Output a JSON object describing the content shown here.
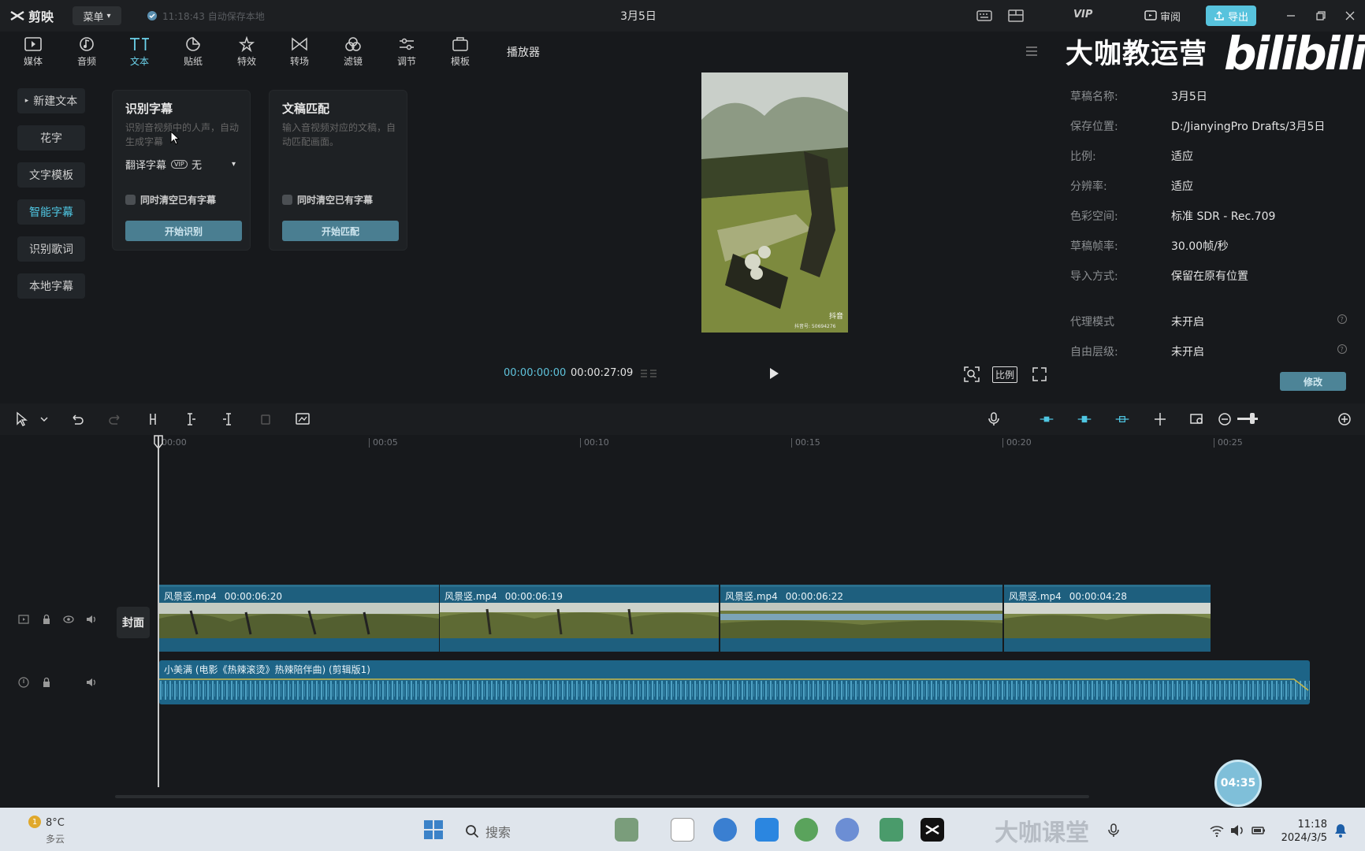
{
  "app": {
    "name": "剪映",
    "menu_label": "菜单",
    "save_status": "11:18:43 自动保存本地",
    "project_title": "3月5日",
    "vip_label": "VIP",
    "review_label": "审阅",
    "export_label": "导出"
  },
  "toolbar": {
    "items": [
      {
        "label": "媒体",
        "icon": "media-icon"
      },
      {
        "label": "音频",
        "icon": "audio-icon"
      },
      {
        "label": "文本",
        "icon": "text-icon"
      },
      {
        "label": "贴纸",
        "icon": "sticker-icon"
      },
      {
        "label": "特效",
        "icon": "effects-icon"
      },
      {
        "label": "转场",
        "icon": "transition-icon"
      },
      {
        "label": "滤镜",
        "icon": "filter-icon"
      },
      {
        "label": "调节",
        "icon": "adjust-icon"
      },
      {
        "label": "模板",
        "icon": "template-icon"
      }
    ],
    "active": "文本"
  },
  "text_panel": {
    "nav": [
      "新建文本",
      "花字",
      "文字模板",
      "智能字幕",
      "识别歌词",
      "本地字幕"
    ],
    "active_nav": "智能字幕",
    "cards": [
      {
        "title": "识别字幕",
        "desc": "识别音视频中的人声，自动生成字幕",
        "translate_label": "翻译字幕",
        "translate_badge": "VIP",
        "translate_value": "无",
        "checkbox": "同时清空已有字幕",
        "button": "开始识别"
      },
      {
        "title": "文稿匹配",
        "desc": "输入音视频对应的文稿，自动匹配画面。",
        "checkbox": "同时清空已有字幕",
        "button": "开始匹配"
      }
    ]
  },
  "player": {
    "title": "播放器",
    "current_time": "00:00:00:00",
    "total_time": "00:00:27:09",
    "ratio_label": "比例",
    "preview_watermark": "抖音",
    "preview_id": "抖音号: 50694276"
  },
  "watermark": {
    "text": "大咖教运营",
    "brand": "bilibili"
  },
  "draft": {
    "rows": [
      {
        "label": "草稿名称:",
        "value": "3月5日"
      },
      {
        "label": "保存位置:",
        "value": "D:/JianyingPro Drafts/3月5日"
      },
      {
        "label": "比例:",
        "value": "适应"
      },
      {
        "label": "分辨率:",
        "value": "适应"
      },
      {
        "label": "色彩空间:",
        "value": "标准 SDR - Rec.709"
      },
      {
        "label": "草稿帧率:",
        "value": "30.00帧/秒"
      },
      {
        "label": "导入方式:",
        "value": "保留在原有位置"
      },
      {
        "label": "代理模式",
        "value": "未开启"
      },
      {
        "label": "自由层级:",
        "value": "未开启"
      }
    ],
    "modify_label": "修改"
  },
  "timeline": {
    "ruler": [
      "00:00",
      "00:05",
      "00:10",
      "00:15",
      "00:20",
      "00:25"
    ],
    "cover_label": "封面",
    "clips": [
      {
        "name": "风景竖.mp4",
        "duration": "00:00:06:20"
      },
      {
        "name": "风景竖.mp4",
        "duration": "00:00:06:19"
      },
      {
        "name": "风景竖.mp4",
        "duration": "00:00:06:22"
      },
      {
        "name": "风景竖.mp4",
        "duration": "00:00:04:28"
      }
    ],
    "audio_label": "小美满 (电影《热辣滚烫》热辣陪伴曲) (剪辑版1)"
  },
  "recorder": {
    "time": "04:35"
  },
  "taskbar": {
    "weather_temp": "8°C",
    "weather_desc": "多云",
    "weather_badge": "1",
    "search_placeholder": "搜索",
    "clock_time": "11:18",
    "clock_date": "2024/3/5",
    "watermark": "大咖课堂"
  },
  "colors": {
    "accent": "#57c3dd",
    "clip": "#1e5f7e",
    "audio": "#1d6487"
  }
}
